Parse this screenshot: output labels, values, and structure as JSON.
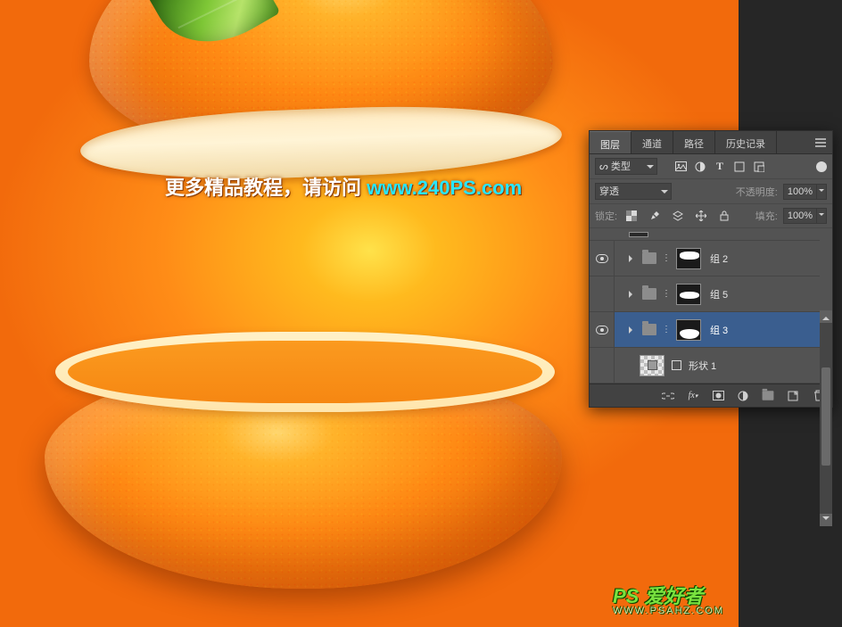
{
  "canvas": {
    "watermark_prefix": "更多精品教程，请访问 ",
    "watermark_link": "www.240PS.com",
    "logo_main": "PS 爱好者",
    "logo_sub": "WWW.PSAHZ.COM"
  },
  "panel": {
    "tabs": [
      {
        "label": "图层",
        "active": true
      },
      {
        "label": "通道",
        "active": false
      },
      {
        "label": "路径",
        "active": false
      },
      {
        "label": "历史记录",
        "active": false
      }
    ],
    "filter": {
      "prefix": "ᔕ",
      "mode": "类型"
    },
    "filter_icons": [
      "image-icon",
      "adjustment-icon",
      "type-icon",
      "shape-icon",
      "smartobject-icon"
    ],
    "blend_mode": "穿透",
    "opacity_label": "不透明度:",
    "opacity_value": "100%",
    "lock_label": "锁定:",
    "lock_icons": [
      "lock-transparency-icon",
      "lock-brush-icon",
      "lock-artboard-icon",
      "lock-position-icon",
      "lock-all-icon"
    ],
    "fill_label": "填充:",
    "fill_value": "100%",
    "layers": [
      {
        "visible": true,
        "type": "group",
        "name": "组 2",
        "selected": false,
        "mask": "top"
      },
      {
        "visible": false,
        "type": "group",
        "name": "组 5",
        "selected": false,
        "mask": "mid"
      },
      {
        "visible": true,
        "type": "group",
        "name": "组 3",
        "selected": true,
        "mask": "bottom"
      },
      {
        "visible": false,
        "type": "shape",
        "name": "形状 1",
        "selected": false
      }
    ],
    "footer_icons": [
      "link-layers-icon",
      "fx-icon",
      "mask-icon",
      "adjustment-new-icon",
      "group-new-icon",
      "new-layer-icon",
      "trash-icon"
    ]
  }
}
